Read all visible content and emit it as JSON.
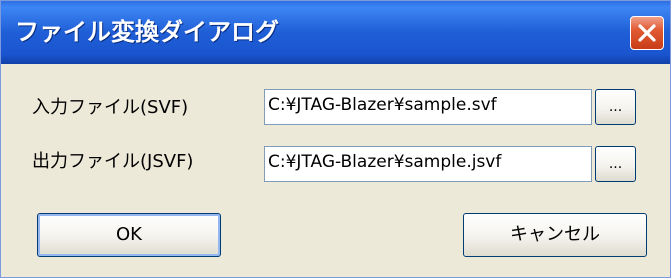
{
  "dialog": {
    "title": "ファイル変換ダイアログ",
    "input_label": "入力ファイル(SVF)",
    "input_value": "C:¥JTAG-Blazer¥sample.svf",
    "output_label": "出力ファイル(JSVF)",
    "output_value": "C:¥JTAG-Blazer¥sample.jsvf",
    "browse_label": "...",
    "ok_label": "OK",
    "cancel_label": "キャンセル"
  },
  "icons": {
    "close": "close-icon"
  },
  "colors": {
    "titlebar": "#1f5ed6",
    "dialog_background": "#ece9d8",
    "close_button": "#e15a33",
    "textbox_border": "#7f9db9"
  }
}
